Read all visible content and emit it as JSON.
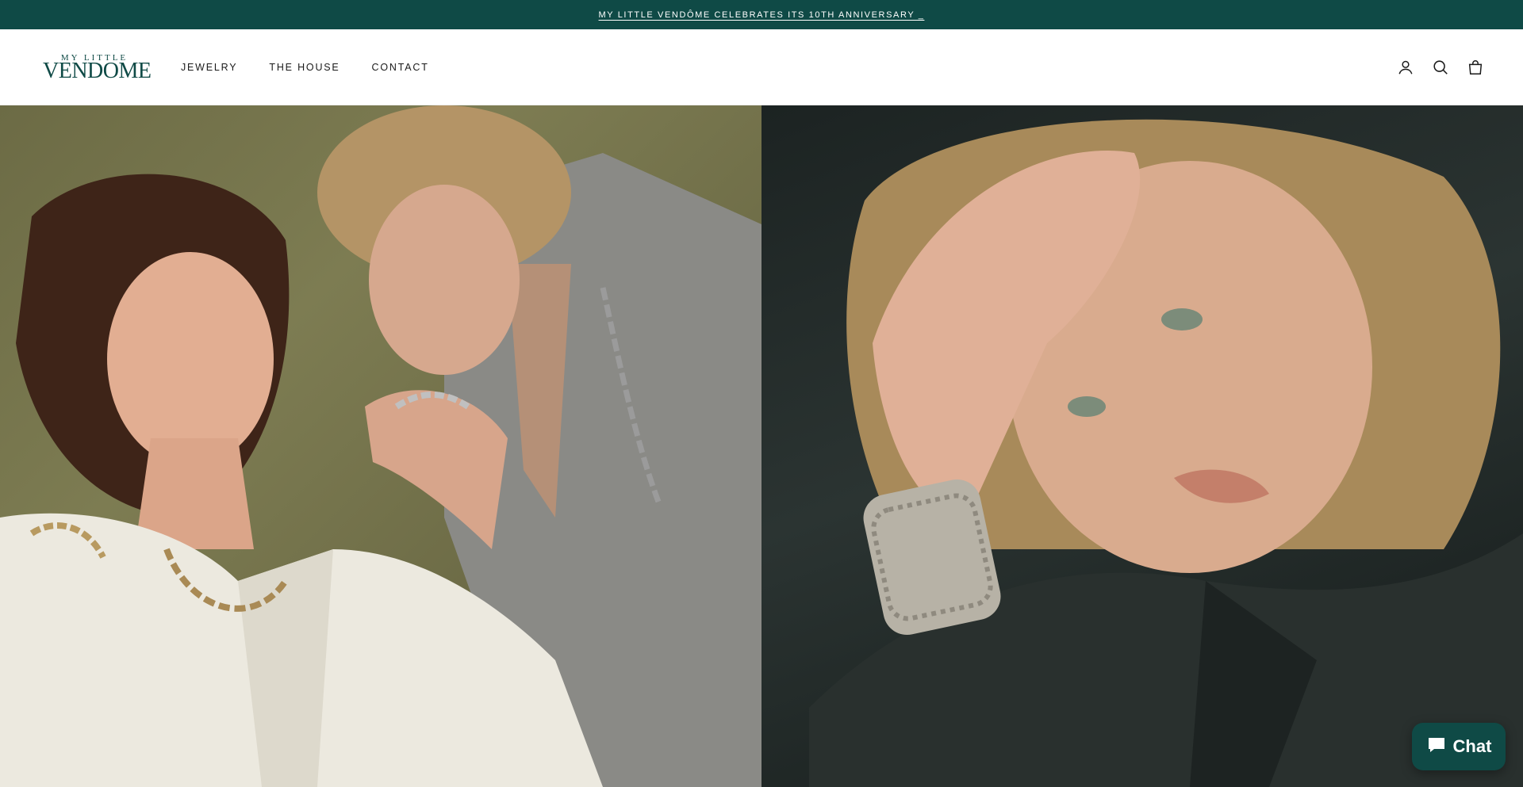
{
  "announcement": {
    "text": "MY LITTLE VENDÔME CELEBRATES ITS 10TH ANNIVERSARY _"
  },
  "header": {
    "logo": {
      "line1": "MY LITTLE",
      "line2": "VENDOME"
    },
    "nav": [
      {
        "label": "JEWELRY"
      },
      {
        "label": "THE HOUSE"
      },
      {
        "label": "CONTACT"
      }
    ],
    "icons": [
      "account-icon",
      "search-icon",
      "cart-icon"
    ]
  },
  "hero": {
    "panels": [
      {
        "name": "two women wearing chain bracelets and necklace"
      },
      {
        "name": "woman wearing chainmail cuff bracelet"
      }
    ]
  },
  "chat": {
    "label": "Chat"
  },
  "colors": {
    "brand": "#0f4a46",
    "text": "#1a1a1a",
    "background": "#ffffff"
  }
}
